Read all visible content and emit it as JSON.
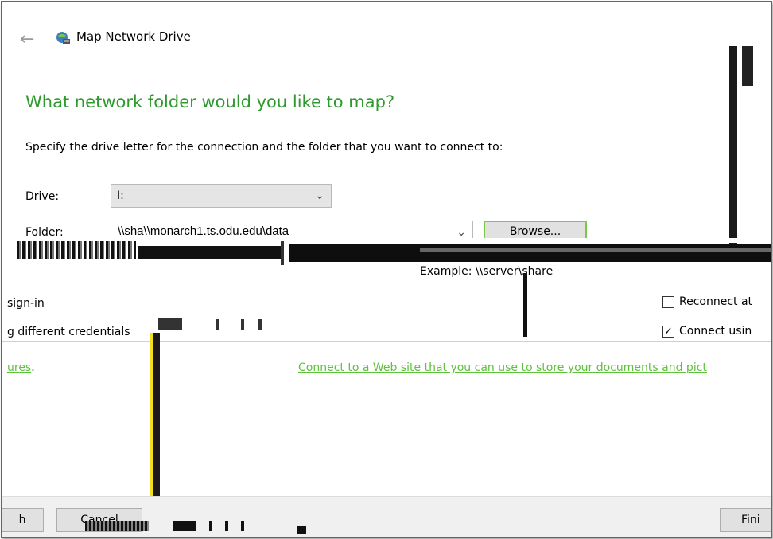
{
  "window": {
    "title": "Map Network Drive"
  },
  "page": {
    "heading": "What network folder would you like to map?",
    "instruction": "Specify the drive letter for the connection and the folder that you want to connect to:"
  },
  "form": {
    "drive_label": "Drive:",
    "drive_value": "I:",
    "folder_label": "Folder:",
    "folder_value": "\\\\monarch1.ts.odu.edu\\data",
    "folder_partial_prefix": "\\\\sha",
    "browse_label": "Browse...",
    "example_text": "Example: \\\\server\\share"
  },
  "options": {
    "sign_in_fragment": "sign-in",
    "credentials_fragment": "g different credentials",
    "reconnect_label": "Reconnect at",
    "reconnect_checked": false,
    "connect_label": "Connect usin",
    "connect_checked": true
  },
  "links": {
    "pictures_fragment": "ures",
    "pictures_suffix": ".",
    "website_link": "Connect to a Web site that you can use to store your documents and pict"
  },
  "footer": {
    "left_fragment": "h",
    "cancel_label": "Cancel",
    "finish_label": "Fini"
  },
  "colors": {
    "heading": "#2e9a2e",
    "link": "#5cc33a",
    "browse_border": "#7ac943",
    "frame_border": "#3b6ea5"
  }
}
